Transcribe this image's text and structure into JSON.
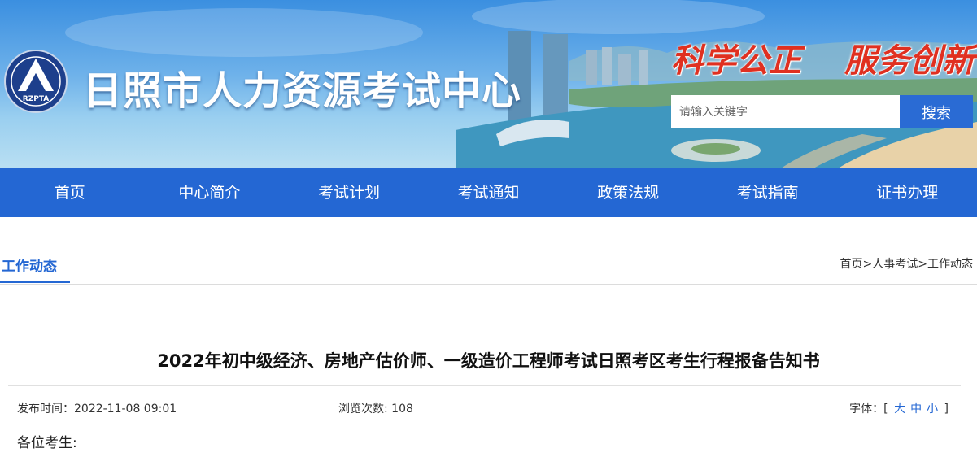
{
  "header": {
    "site_title": "日照市人力资源考试中心",
    "logo_text": "RZPTA",
    "slogan_left": "科学公正",
    "slogan_right": "服务创新",
    "search": {
      "placeholder": "请输入关键字",
      "button_label": "搜索"
    }
  },
  "nav": {
    "items": [
      {
        "label": "首页"
      },
      {
        "label": "中心简介"
      },
      {
        "label": "考试计划"
      },
      {
        "label": "考试通知"
      },
      {
        "label": "政策法规"
      },
      {
        "label": "考试指南"
      },
      {
        "label": "证书办理"
      }
    ]
  },
  "section": {
    "title": "工作动态",
    "breadcrumb": {
      "home": "首页",
      "sep": ">",
      "level1": "人事考试",
      "level2": "工作动态"
    }
  },
  "article": {
    "title": "2022年初中级经济、房地产估价师、一级造价工程师考试日照考区考生行程报备告知书",
    "publish_label": "发布时间：",
    "publish_time": "2022-11-08 09:01",
    "views_label": "浏览次数: ",
    "views": "108",
    "font_label": "字体：",
    "font_open": "[",
    "font_large": "大",
    "font_medium": "中",
    "font_small": "小",
    "font_close": "]",
    "greeting": "各位考生:"
  },
  "colors": {
    "nav_bg": "#2467d3",
    "accent": "#2467d3",
    "slogan": "#e03020"
  }
}
